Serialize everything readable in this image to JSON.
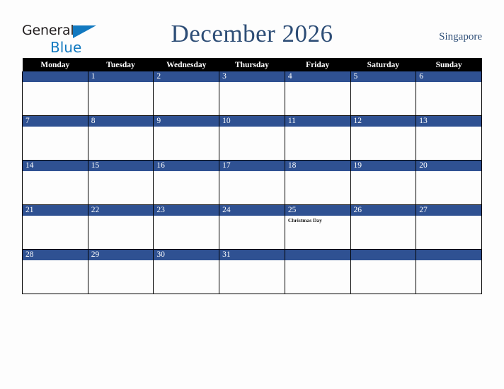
{
  "brand": {
    "word_one": "General",
    "word_two": "Blue",
    "triangle_icon": "blue-triangle-icon",
    "dark_color": "#231f20",
    "blue_color": "#1279c0"
  },
  "header": {
    "title": "December 2026",
    "country": "Singapore",
    "title_color": "#2d4d76"
  },
  "theme": {
    "header_row_bg": "#000000",
    "header_row_text": "#ffffff",
    "date_bar_bg": "#2f5192",
    "date_bar_text": "#ffffff",
    "cell_bg": "#fdfdfd",
    "page_bg": "#fdfdfd",
    "border": "#000000"
  },
  "weekday_headers": [
    "Monday",
    "Tuesday",
    "Wednesday",
    "Thursday",
    "Friday",
    "Saturday",
    "Sunday"
  ],
  "weeks": [
    [
      {
        "date": "",
        "event": ""
      },
      {
        "date": "1",
        "event": ""
      },
      {
        "date": "2",
        "event": ""
      },
      {
        "date": "3",
        "event": ""
      },
      {
        "date": "4",
        "event": ""
      },
      {
        "date": "5",
        "event": ""
      },
      {
        "date": "6",
        "event": ""
      }
    ],
    [
      {
        "date": "7",
        "event": ""
      },
      {
        "date": "8",
        "event": ""
      },
      {
        "date": "9",
        "event": ""
      },
      {
        "date": "10",
        "event": ""
      },
      {
        "date": "11",
        "event": ""
      },
      {
        "date": "12",
        "event": ""
      },
      {
        "date": "13",
        "event": ""
      }
    ],
    [
      {
        "date": "14",
        "event": ""
      },
      {
        "date": "15",
        "event": ""
      },
      {
        "date": "16",
        "event": ""
      },
      {
        "date": "17",
        "event": ""
      },
      {
        "date": "18",
        "event": ""
      },
      {
        "date": "19",
        "event": ""
      },
      {
        "date": "20",
        "event": ""
      }
    ],
    [
      {
        "date": "21",
        "event": ""
      },
      {
        "date": "22",
        "event": ""
      },
      {
        "date": "23",
        "event": ""
      },
      {
        "date": "24",
        "event": ""
      },
      {
        "date": "25",
        "event": "Christmas Day"
      },
      {
        "date": "26",
        "event": ""
      },
      {
        "date": "27",
        "event": ""
      }
    ],
    [
      {
        "date": "28",
        "event": ""
      },
      {
        "date": "29",
        "event": ""
      },
      {
        "date": "30",
        "event": ""
      },
      {
        "date": "31",
        "event": ""
      },
      {
        "date": "",
        "event": ""
      },
      {
        "date": "",
        "event": ""
      },
      {
        "date": "",
        "event": ""
      }
    ]
  ]
}
